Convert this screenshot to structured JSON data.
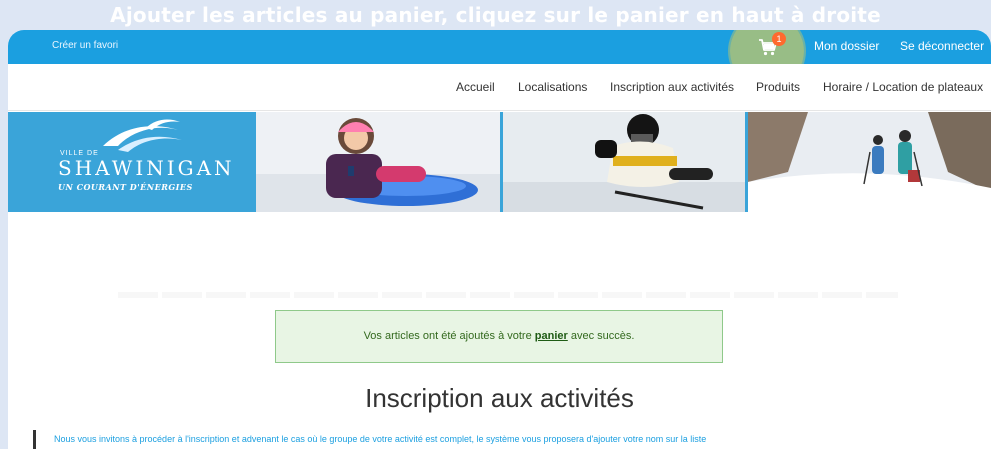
{
  "overlay_heading": "Ajouter les articles au panier, cliquez sur le panier en haut à droite",
  "topbar": {
    "create_favorite": "Créer un favori",
    "cart_count": "1",
    "my_account": "Mon dossier",
    "logout": "Se déconnecter"
  },
  "nav": {
    "items": [
      {
        "label": "Accueil"
      },
      {
        "label": "Localisations"
      },
      {
        "label": "Inscription aux activités"
      },
      {
        "label": "Produits"
      },
      {
        "label": "Horaire / Location de plateaux"
      }
    ]
  },
  "banner": {
    "ville_de": "VILLE DE",
    "city_name": "SHAWINIGAN",
    "tagline": "UN COURANT D'ÉNERGIES"
  },
  "alert": {
    "before": "Vos articles ont été ajoutés à votre ",
    "link": "panier",
    "after": " avec succès."
  },
  "page": {
    "title": "Inscription aux activités",
    "intro": "Nous vous invitons à procéder à l'inscription et advenant le cas où le groupe de votre activité est complet, le système vous proposera d'ajouter votre nom sur la liste"
  },
  "colors": {
    "topbar": "#1b9fe0",
    "highlight": "#ffd63c",
    "badge": "#ff6a2e",
    "alert_bg": "#e8f5e4"
  }
}
